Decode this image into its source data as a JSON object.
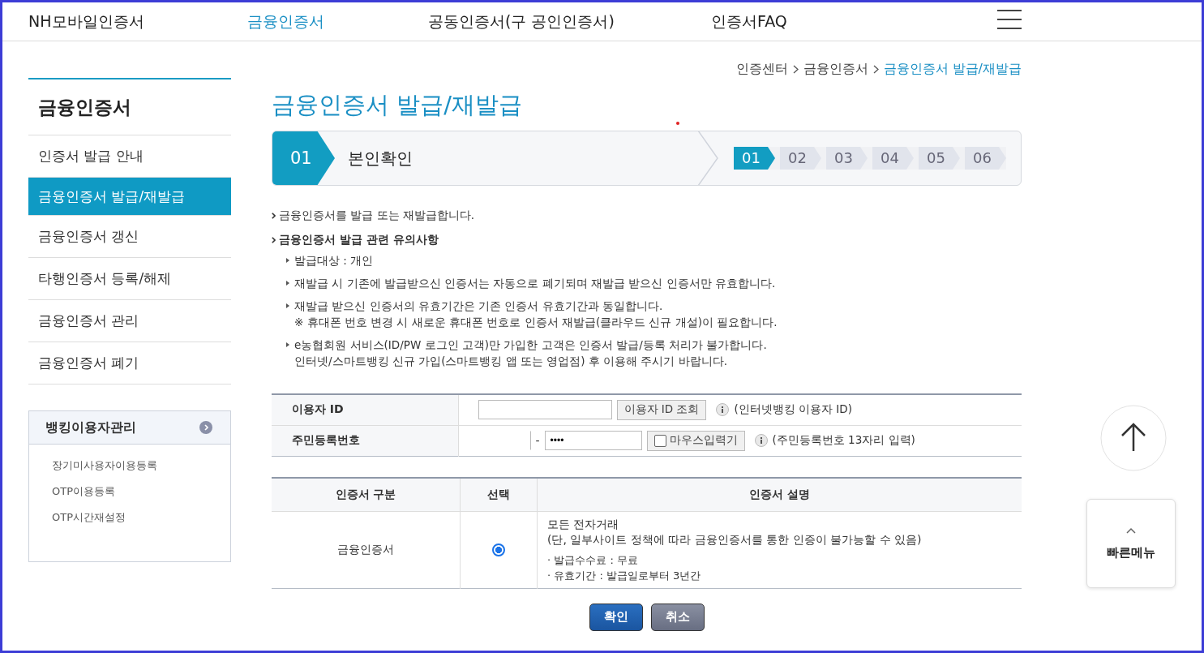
{
  "nav": {
    "items": [
      {
        "label": "NH모바일인증서",
        "selected": false
      },
      {
        "label": "금융인증서",
        "selected": true
      },
      {
        "label": "공동인증서(구 공인인증서)",
        "selected": false
      },
      {
        "label": "인증서FAQ",
        "selected": false
      }
    ]
  },
  "sidebar": {
    "title": "금융인증서",
    "items": [
      {
        "label": "인증서 발급 안내",
        "selected": false
      },
      {
        "label": "금융인증서 발급/재발급",
        "selected": true
      },
      {
        "label": "금융인증서 갱신",
        "selected": false
      },
      {
        "label": "타행인증서 등록/해제",
        "selected": false
      },
      {
        "label": "금융인증서 관리",
        "selected": false
      },
      {
        "label": "금융인증서 폐기",
        "selected": false
      }
    ],
    "box": {
      "title": "뱅킹이용자관리",
      "links": [
        "장기미사용자이용등록",
        "OTP이용등록",
        "OTP시간재설정"
      ]
    }
  },
  "breadcrumb": [
    {
      "label": "인증센터",
      "selected": false
    },
    {
      "label": "금융인증서",
      "selected": false
    },
    {
      "label": "금융인증서 발급/재발급",
      "selected": true
    }
  ],
  "page_title": "금융인증서 발급/재발급",
  "stepper": {
    "current_number": "01",
    "current_label": "본인확인",
    "steps": [
      {
        "label": "01",
        "selected": true
      },
      {
        "label": "02",
        "selected": false
      },
      {
        "label": "03",
        "selected": false
      },
      {
        "label": "04",
        "selected": false
      },
      {
        "label": "05",
        "selected": false
      },
      {
        "label": "06",
        "selected": false
      }
    ]
  },
  "intro": "금융인증서를 발급 또는 재발급합니다.",
  "notice": {
    "title": "금융인증서 발급 관련 유의사항",
    "items": [
      {
        "lines": [
          "발급대상 : 개인"
        ]
      },
      {
        "lines": [
          "재발급 시 기존에 발급받으신 인증서는 자동으로 폐기되며 재발급 받으신 인증서만 유효합니다."
        ]
      },
      {
        "lines": [
          "재발급 받으신 인증서의 유효기간은 기존 인증서 유효기간과 동일합니다.",
          "※ 휴대폰 번호 변경 시 새로운 휴대폰 번호로 인증서 재발급(클라우드 신규 개설)이 필요합니다."
        ]
      },
      {
        "lines": [
          "e농협회원 서비스(ID/PW 로그인 고객)만 가입한 고객은 인증서 발급/등록 처리가 불가합니다.",
          "인터넷/스마트뱅킹 신규 가입(스마트뱅킹 앱 또는 영업점) 후 이용해 주시기 바랍니다."
        ]
      }
    ]
  },
  "form": {
    "user_id": {
      "label": "이용자 ID",
      "button": "이용자 ID 조회",
      "hint": "(인터넷뱅킹 이용자 ID)"
    },
    "resident": {
      "label": "주민등록번호",
      "separator": "-",
      "second_value": "••••",
      "mouse_input": {
        "label": "마우스입력기",
        "checked": false
      },
      "hint": "(주민등록번호 13자리 입력)"
    }
  },
  "cert_table": {
    "columns": [
      "인증서 구분",
      "선택",
      "인증서 설명"
    ],
    "rows": [
      {
        "type": "금융인증서",
        "selected": true,
        "desc_title": "모든 전자거래",
        "desc_note": "(단, 일부사이트 정책에 따라 금융인증서를 통한 인증이 불가능할 수 있음)",
        "details": [
          "· 발급수수료 : 무료",
          "· 유효기간 : 발급일로부터 3년간"
        ]
      }
    ]
  },
  "buttons": [
    {
      "label": "확인",
      "kind": "primary"
    },
    {
      "label": "취소",
      "kind": "secondary"
    }
  ],
  "quick_menu": {
    "label": "빠른메뉴"
  }
}
